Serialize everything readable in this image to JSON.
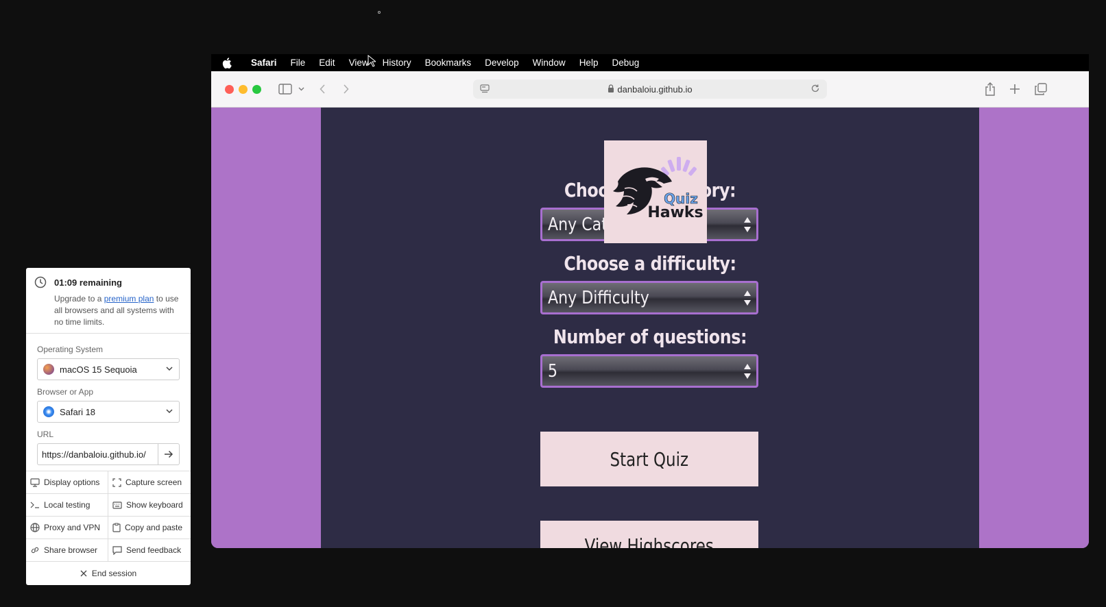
{
  "menubar": {
    "app": "Safari",
    "items": [
      "File",
      "Edit",
      "View",
      "History",
      "Bookmarks",
      "Develop",
      "Window",
      "Help",
      "Debug"
    ]
  },
  "browser": {
    "address": "danbaloiu.github.io"
  },
  "page": {
    "category_label": "Choose a category:",
    "category_value": "Any Category",
    "difficulty_label": "Choose a difficulty:",
    "difficulty_value": "Any Difficulty",
    "count_label": "Number of questions:",
    "count_value": "5",
    "start_button": "Start Quiz",
    "highscores_button": "View Highscores",
    "logo_text_1": "Quiz",
    "logo_text_2": "Hawks"
  },
  "session_panel": {
    "timer": "01:09 remaining",
    "upgrade_pre": "Upgrade to a",
    "upgrade_link": "premium plan",
    "upgrade_post": "to use all browsers and all systems with no time limits.",
    "os_label": "Operating System",
    "os_value": "macOS 15 Sequoia",
    "browser_label": "Browser or App",
    "browser_value": "Safari 18",
    "url_label": "URL",
    "url_value": "https://danbaloiu.github.io/",
    "actions": {
      "display": "Display options",
      "capture": "Capture screen",
      "local": "Local testing",
      "keyboard": "Show keyboard",
      "proxy": "Proxy and VPN",
      "copy": "Copy and paste",
      "share": "Share browser",
      "feedback": "Send feedback"
    },
    "end": "End session"
  },
  "colors": {
    "page_bg": "#ad73c8",
    "panel_bg": "#2e2c45",
    "button_bg": "#f0dbe0",
    "select_border": "#a86fd0",
    "link": "#2563c9"
  }
}
